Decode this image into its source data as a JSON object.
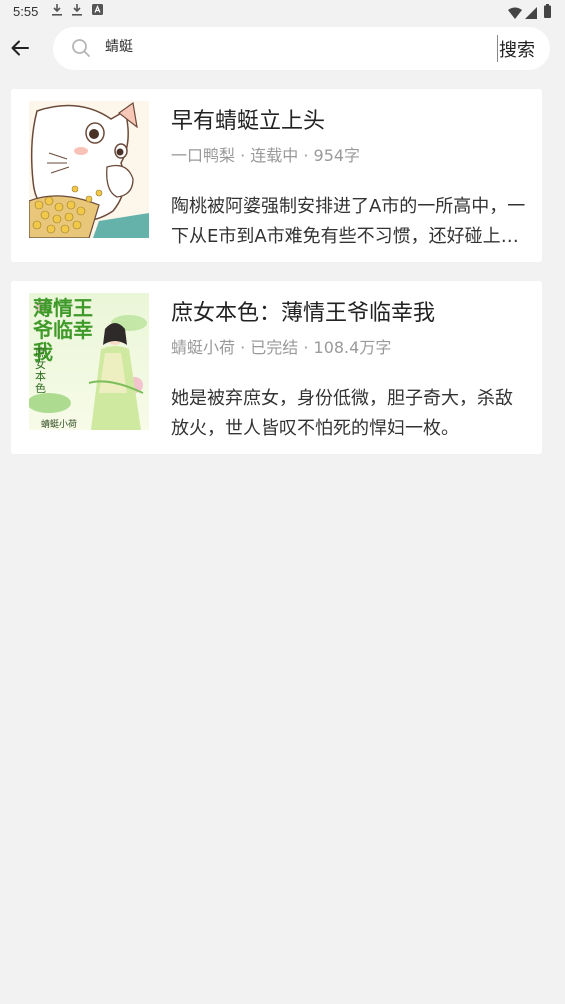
{
  "status_bar": {
    "time": "5:55",
    "icons_left": [
      "download-icon",
      "download-icon",
      "app-icon"
    ],
    "icons_right": [
      "wifi-icon",
      "signal-icon",
      "battery-icon"
    ]
  },
  "header": {
    "back_icon": "arrow-left-icon",
    "search": {
      "value": "蜻蜓",
      "icon": "search-icon",
      "button_label": "搜索"
    }
  },
  "books": [
    {
      "title": "早有蜻蜓立上头",
      "meta": "一口鸭梨 · 连载中 · 954字",
      "description": "陶桃被阿婆强制安排进了A市的一所高中，一下从E市到A市难免有些不习惯，还好碰上了一群好朋友，陪她一起度过高中时光。",
      "cover": "cat-illustration"
    },
    {
      "title": "庶女本色：薄情王爷临幸我",
      "meta": "蜻蜓小荷 · 已完结 · 108.4万字",
      "description": "她是被弃庶女，身份低微，胆子奇大，杀敌放火，世人皆叹不怕死的悍妇一枚。",
      "cover": "ancient-lady-illustration",
      "cover_text": {
        "main": "薄情王爷临幸我",
        "sub": "庶女本色",
        "author": "蜻蜓小荷"
      }
    }
  ],
  "colors": {
    "background": "#f2f2f2",
    "card": "#ffffff",
    "meta_text": "#9a9a9a"
  }
}
